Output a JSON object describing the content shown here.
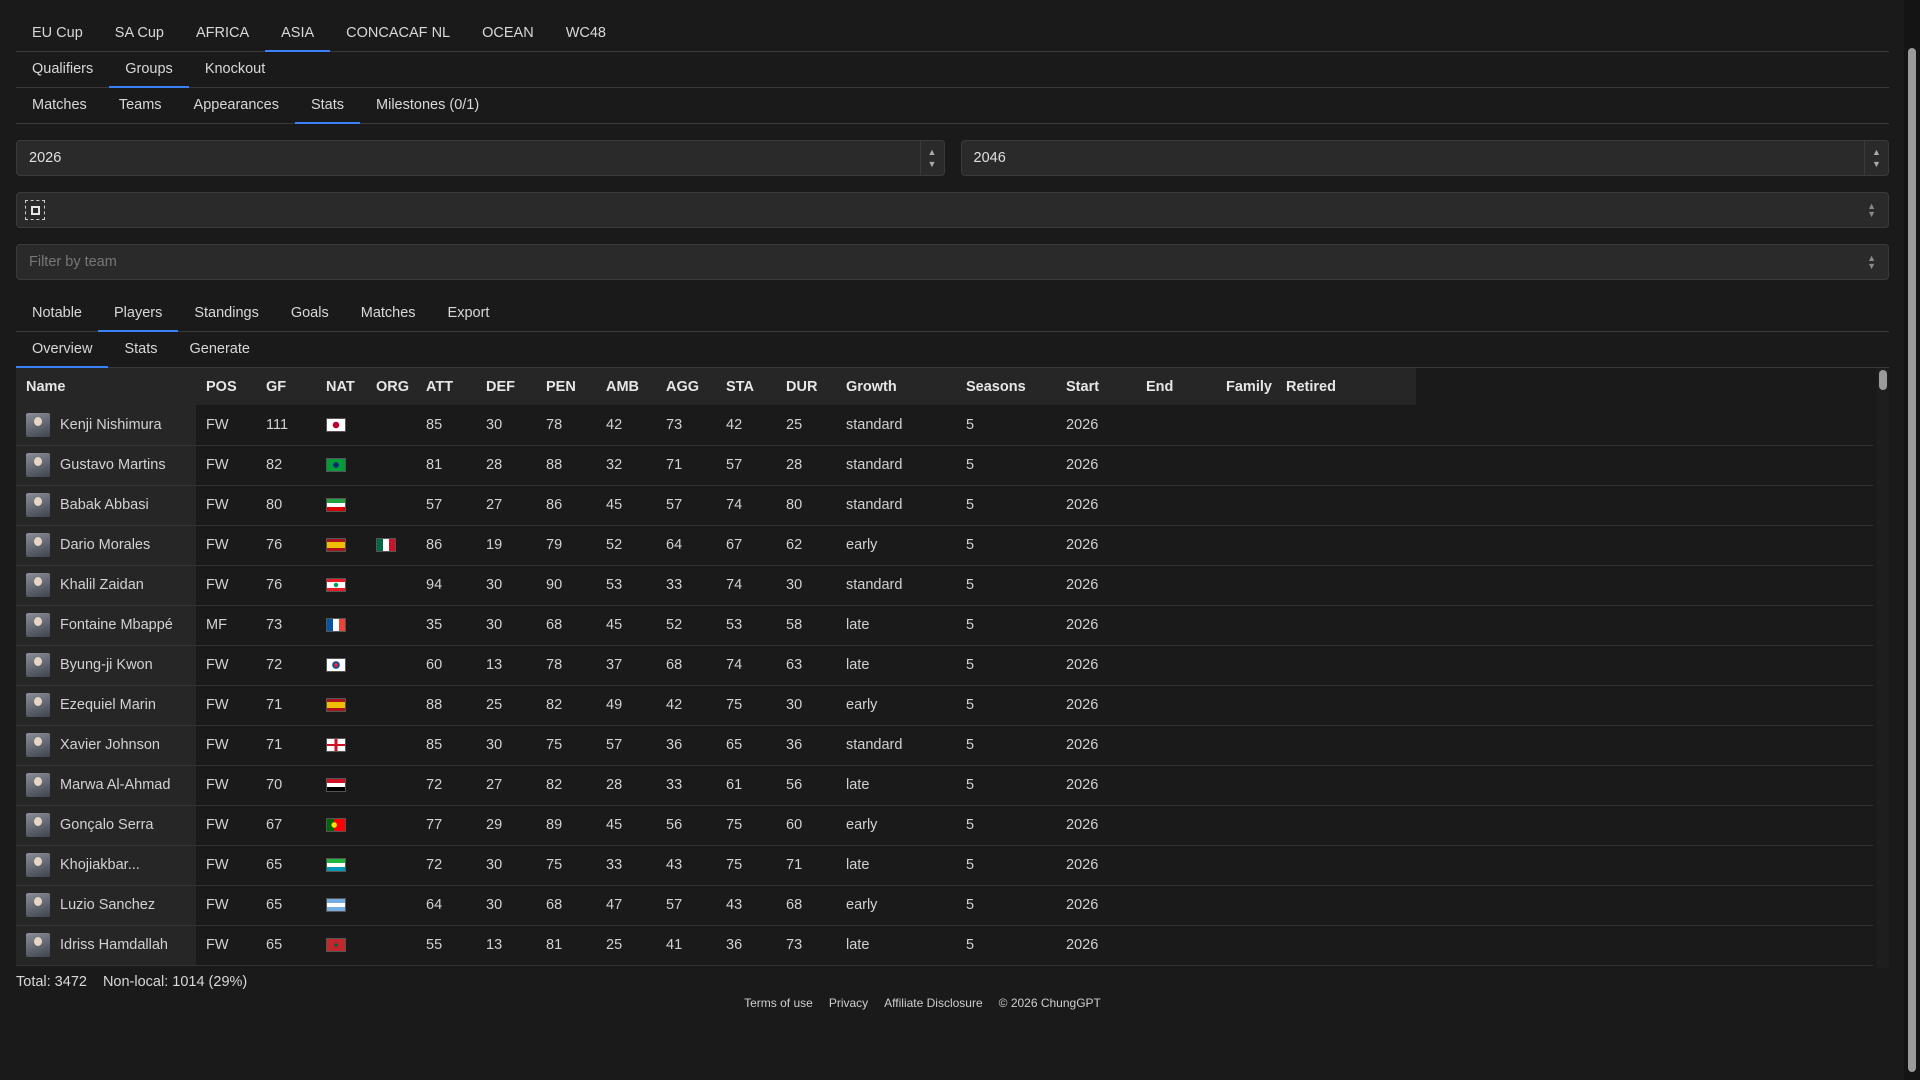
{
  "top_tabs": [
    "EU Cup",
    "SA Cup",
    "AFRICA",
    "ASIA",
    "CONCACAF NL",
    "OCEAN",
    "WC48"
  ],
  "stage_tabs": [
    "Qualifiers",
    "Groups",
    "Knockout"
  ],
  "view_tabs": [
    "Matches",
    "Teams",
    "Appearances",
    "Stats",
    "Milestones (0/1)"
  ],
  "year_from": "2026",
  "year_to": "2046",
  "filter_placeholder": "Filter by team",
  "section_tabs": [
    "Notable",
    "Players",
    "Standings",
    "Goals",
    "Matches",
    "Export"
  ],
  "player_tabs": [
    "Overview",
    "Stats",
    "Generate"
  ],
  "columns": [
    "Name",
    "POS",
    "GF",
    "NAT",
    "ORG",
    "ATT",
    "DEF",
    "PEN",
    "AMB",
    "AGG",
    "STA",
    "DUR",
    "Growth",
    "Seasons",
    "Start",
    "End",
    "Family",
    "Retired"
  ],
  "rows": [
    {
      "name": "Kenji Nishimura",
      "pos": "FW",
      "gf": "111",
      "nat": "japan",
      "org": "",
      "att": "85",
      "def": "30",
      "pen": "78",
      "amb": "42",
      "agg": "73",
      "sta": "42",
      "dur": "25",
      "growth": "standard",
      "seasons": "5",
      "start": "2026",
      "end": "",
      "family": "",
      "retired": ""
    },
    {
      "name": "Gustavo Martins",
      "pos": "FW",
      "gf": "82",
      "nat": "brazil",
      "org": "",
      "att": "81",
      "def": "28",
      "pen": "88",
      "amb": "32",
      "agg": "71",
      "sta": "57",
      "dur": "28",
      "growth": "standard",
      "seasons": "5",
      "start": "2026",
      "end": "",
      "family": "",
      "retired": ""
    },
    {
      "name": "Babak Abbasi",
      "pos": "FW",
      "gf": "80",
      "nat": "iran",
      "org": "",
      "att": "57",
      "def": "27",
      "pen": "86",
      "amb": "45",
      "agg": "57",
      "sta": "74",
      "dur": "80",
      "growth": "standard",
      "seasons": "5",
      "start": "2026",
      "end": "",
      "family": "",
      "retired": ""
    },
    {
      "name": "Dario Morales",
      "pos": "FW",
      "gf": "76",
      "nat": "spain",
      "org": "mexico",
      "att": "86",
      "def": "19",
      "pen": "79",
      "amb": "52",
      "agg": "64",
      "sta": "67",
      "dur": "62",
      "growth": "early",
      "seasons": "5",
      "start": "2026",
      "end": "",
      "family": "",
      "retired": ""
    },
    {
      "name": "Khalil Zaidan",
      "pos": "FW",
      "gf": "76",
      "nat": "lebanon",
      "org": "",
      "att": "94",
      "def": "30",
      "pen": "90",
      "amb": "53",
      "agg": "33",
      "sta": "74",
      "dur": "30",
      "growth": "standard",
      "seasons": "5",
      "start": "2026",
      "end": "",
      "family": "",
      "retired": ""
    },
    {
      "name": "Fontaine Mbappé",
      "pos": "MF",
      "gf": "73",
      "nat": "france",
      "org": "",
      "att": "35",
      "def": "30",
      "pen": "68",
      "amb": "45",
      "agg": "52",
      "sta": "53",
      "dur": "58",
      "growth": "late",
      "seasons": "5",
      "start": "2026",
      "end": "",
      "family": "",
      "retired": ""
    },
    {
      "name": "Byung-ji Kwon",
      "pos": "FW",
      "gf": "72",
      "nat": "korea",
      "org": "",
      "att": "60",
      "def": "13",
      "pen": "78",
      "amb": "37",
      "agg": "68",
      "sta": "74",
      "dur": "63",
      "growth": "late",
      "seasons": "5",
      "start": "2026",
      "end": "",
      "family": "",
      "retired": ""
    },
    {
      "name": "Ezequiel Marin",
      "pos": "FW",
      "gf": "71",
      "nat": "spain",
      "org": "",
      "att": "88",
      "def": "25",
      "pen": "82",
      "amb": "49",
      "agg": "42",
      "sta": "75",
      "dur": "30",
      "growth": "early",
      "seasons": "5",
      "start": "2026",
      "end": "",
      "family": "",
      "retired": ""
    },
    {
      "name": "Xavier Johnson",
      "pos": "FW",
      "gf": "71",
      "nat": "england",
      "org": "",
      "att": "85",
      "def": "30",
      "pen": "75",
      "amb": "57",
      "agg": "36",
      "sta": "65",
      "dur": "36",
      "growth": "standard",
      "seasons": "5",
      "start": "2026",
      "end": "",
      "family": "",
      "retired": ""
    },
    {
      "name": "Marwa Al-Ahmad",
      "pos": "FW",
      "gf": "70",
      "nat": "syria",
      "org": "",
      "att": "72",
      "def": "27",
      "pen": "82",
      "amb": "28",
      "agg": "33",
      "sta": "61",
      "dur": "56",
      "growth": "late",
      "seasons": "5",
      "start": "2026",
      "end": "",
      "family": "",
      "retired": ""
    },
    {
      "name": "Gonçalo Serra",
      "pos": "FW",
      "gf": "67",
      "nat": "portugal",
      "org": "",
      "att": "77",
      "def": "29",
      "pen": "89",
      "amb": "45",
      "agg": "56",
      "sta": "75",
      "dur": "60",
      "growth": "early",
      "seasons": "5",
      "start": "2026",
      "end": "",
      "family": "",
      "retired": ""
    },
    {
      "name": "Khojiakbar...",
      "pos": "FW",
      "gf": "65",
      "nat": "uzbekistan",
      "org": "",
      "att": "72",
      "def": "30",
      "pen": "75",
      "amb": "33",
      "agg": "43",
      "sta": "75",
      "dur": "71",
      "growth": "late",
      "seasons": "5",
      "start": "2026",
      "end": "",
      "family": "",
      "retired": ""
    },
    {
      "name": "Luzio Sanchez",
      "pos": "FW",
      "gf": "65",
      "nat": "argentina",
      "org": "",
      "att": "64",
      "def": "30",
      "pen": "68",
      "amb": "47",
      "agg": "57",
      "sta": "43",
      "dur": "68",
      "growth": "early",
      "seasons": "5",
      "start": "2026",
      "end": "",
      "family": "",
      "retired": ""
    },
    {
      "name": "Idriss Hamdallah",
      "pos": "FW",
      "gf": "65",
      "nat": "morocco",
      "org": "",
      "att": "55",
      "def": "13",
      "pen": "81",
      "amb": "25",
      "agg": "41",
      "sta": "36",
      "dur": "73",
      "growth": "late",
      "seasons": "5",
      "start": "2026",
      "end": "",
      "family": "",
      "retired": ""
    }
  ],
  "total_label": "Total: 3472",
  "nonlocal_label": "Non-local: 1014 (29%)",
  "footer_links": [
    "Terms of use",
    "Privacy",
    "Affiliate Disclosure"
  ],
  "copyright": "© 2026 ChungGPT",
  "accent_color": "#3b82f6"
}
